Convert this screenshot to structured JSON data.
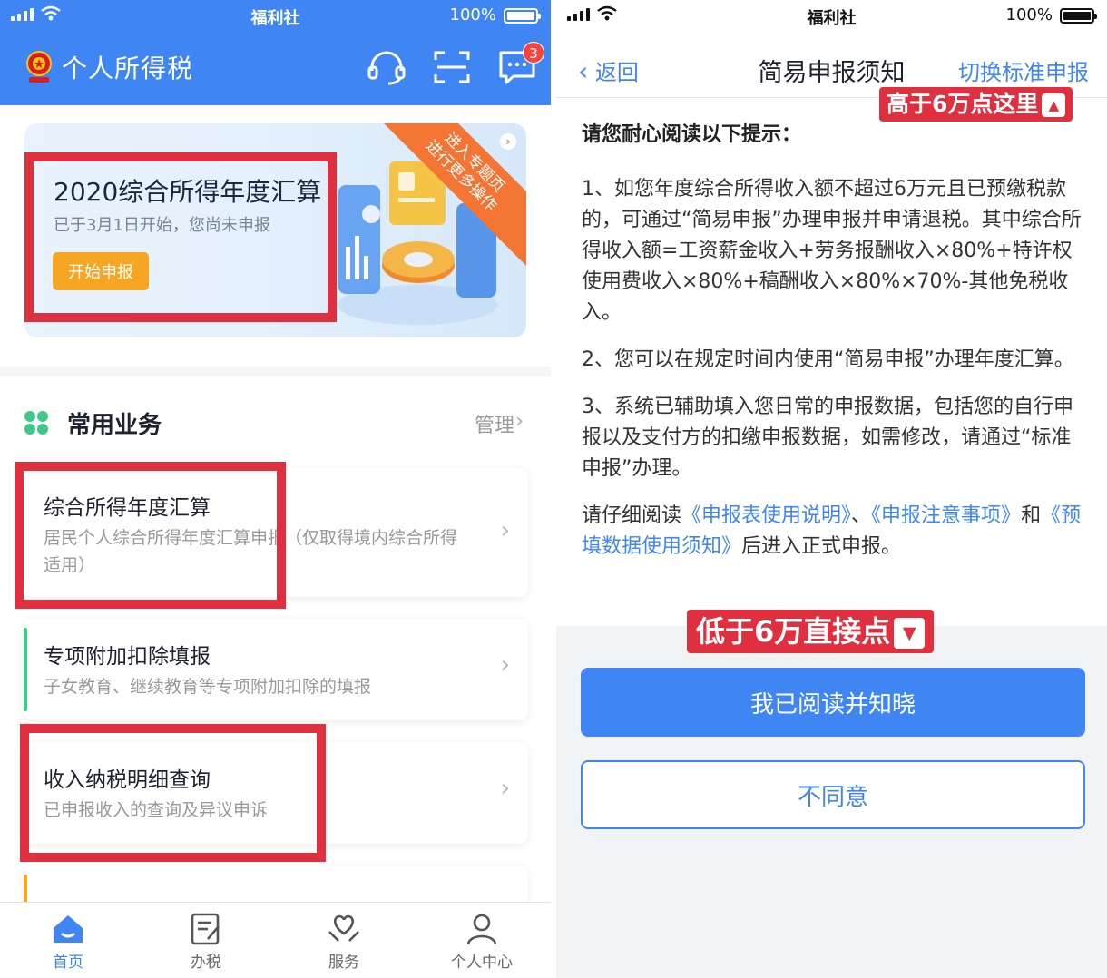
{
  "left": {
    "status_bar": {
      "carrier": "福利社",
      "battery": "100%"
    },
    "header": {
      "title": "个人所得税",
      "message_count": "3"
    },
    "banner": {
      "title": "2020综合所得年度汇算",
      "subtitle": "已于3月1日开始，您尚未申报",
      "button": "开始申报",
      "ribbon_line1": "进入专题页",
      "ribbon_line2": "进行更多操作"
    },
    "common": {
      "title": "常用业务",
      "manage": "管理",
      "items": [
        {
          "title": "综合所得年度汇算",
          "desc": "居民个人综合所得年度汇算申报（仅取得境内综合所得适用）"
        },
        {
          "title": "专项附加扣除填报",
          "desc": "子女教育、继续教育等专项附加扣除的填报"
        },
        {
          "title": "收入纳税明细查询",
          "desc": "已申报收入的查询及异议申诉"
        }
      ]
    },
    "tabs": [
      {
        "label": "首页",
        "icon": "home-icon",
        "active": true
      },
      {
        "label": "办税",
        "icon": "edit-document-icon"
      },
      {
        "label": "服务",
        "icon": "heart-hands-icon"
      },
      {
        "label": "个人中心",
        "icon": "person-icon"
      }
    ]
  },
  "right": {
    "status_bar": {
      "carrier": "福利社",
      "battery": "100%"
    },
    "nav": {
      "back": "返回",
      "title": "简易申报须知",
      "switch": "切换标准申报"
    },
    "annotation_top": "高于6万点这里",
    "annotation_bottom": "低于6万直接点",
    "intro": "请您耐心阅读以下提示：",
    "para1": "1、如您年度综合所得收入额不超过6万元且已预缴税款的，可通过“简易申报”办理申报并申请退税。其中综合所得收入额=工资薪金收入+劳务报酬收入×80%+特许权使用费收入×80%+稿酬收入×80%×70%-其他免税收入。",
    "para2": "2、您可以在规定时间内使用“简易申报”办理年度汇算。",
    "para3": "3、系统已辅助填入您日常的申报数据，包括您的自行申报以及支付方的扣缴申报数据，如需修改，请通过“标准申报”办理。",
    "read_prefix": "请仔细阅读",
    "link1": "《申报表使用说明》",
    "sep1": "、",
    "link2": "《申报注意事项》",
    "sep2": "和",
    "link3": "《预填数据使用须知》",
    "read_suffix": "后进入正式申报。",
    "agree_button": "我已阅读并知晓",
    "disagree_button": "不同意"
  },
  "colors": {
    "primary": "#3f86f4",
    "highlight": "#e0303f",
    "orange": "#f6a623",
    "ribbon": "#f37433"
  }
}
